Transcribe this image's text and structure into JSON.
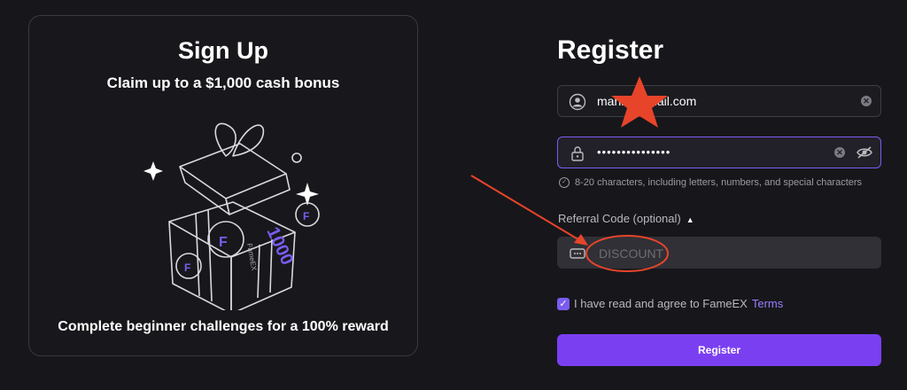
{
  "promo": {
    "title": "Sign Up",
    "subtitle": "Claim up to a $1,000 cash bonus",
    "footer": "Complete beginner challenges for a 100% reward",
    "gift_text": "1000",
    "gift_brand": "FameEX"
  },
  "register": {
    "title": "Register",
    "email_value": "mani            @gmail.com",
    "password_value": "•••••••••••••••",
    "password_hint": "8-20 characters, including letters, numbers, and special characters",
    "referral_label": "Referral Code (optional)",
    "referral_placeholder": "DISCOUNT",
    "agree_text": "I have read and agree to FameEX ",
    "terms_link": "Terms",
    "submit_label": "Register"
  },
  "annotation_colors": {
    "accent": "#7b5cf0",
    "button": "#7b3ff2",
    "markup": "#e8442a"
  }
}
